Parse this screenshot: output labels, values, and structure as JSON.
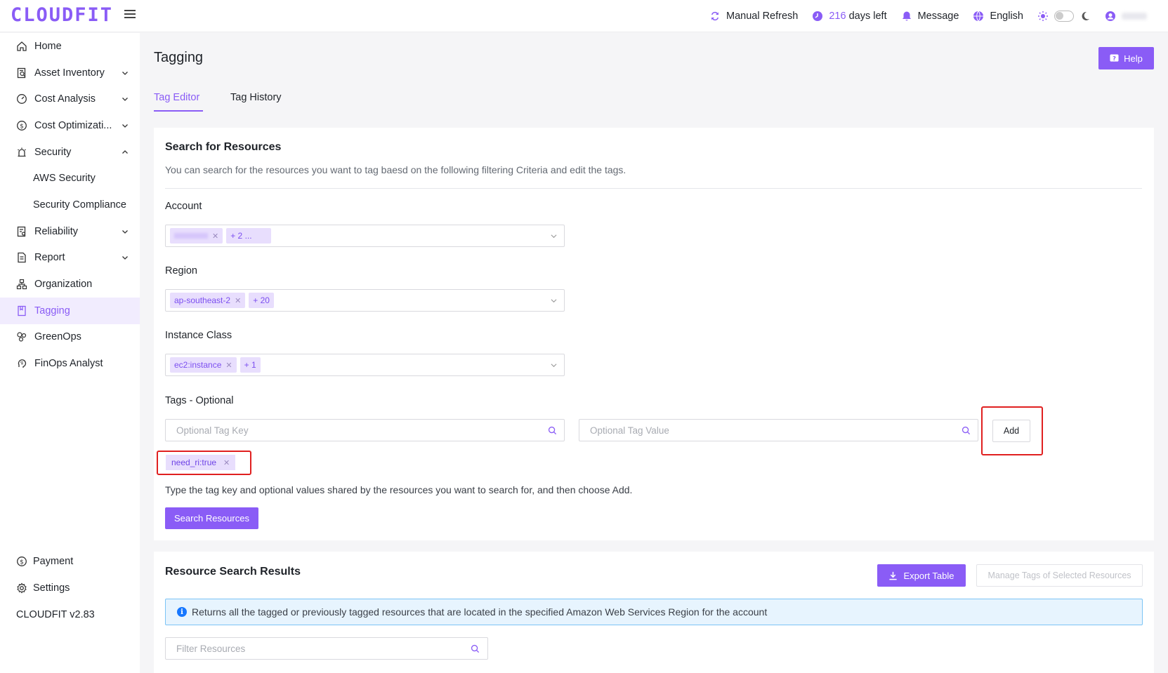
{
  "app": {
    "logo": "CLOUDFIT",
    "version": "CLOUDFIT v2.83"
  },
  "topbar": {
    "refresh_label": "Manual Refresh",
    "days_left_number": "216",
    "days_left_suffix": "days left",
    "message_label": "Message",
    "language_label": "English"
  },
  "sidebar": {
    "items": [
      {
        "label": "Home",
        "icon": "home-icon"
      },
      {
        "label": "Asset Inventory",
        "icon": "inventory-icon"
      },
      {
        "label": "Cost Analysis",
        "icon": "gauge-icon"
      },
      {
        "label": "Cost Optimizati...",
        "icon": "dollar-icon"
      },
      {
        "label": "Security",
        "icon": "alarm-icon"
      },
      {
        "label": "AWS Security"
      },
      {
        "label": "Security Compliance"
      },
      {
        "label": "Reliability",
        "icon": "document-check-icon"
      },
      {
        "label": "Report",
        "icon": "report-icon"
      },
      {
        "label": "Organization",
        "icon": "org-chart-icon"
      },
      {
        "label": "Tagging",
        "icon": "bookmark-icon"
      },
      {
        "label": "GreenOps",
        "icon": "leaf-icon"
      },
      {
        "label": "FinOps Analyst",
        "icon": "brain-icon"
      }
    ],
    "footer": [
      {
        "label": "Payment",
        "icon": "dollar-icon"
      },
      {
        "label": "Settings",
        "icon": "gear-icon"
      }
    ]
  },
  "page": {
    "title": "Tagging",
    "help_label": "Help",
    "tabs": [
      {
        "label": "Tag Editor"
      },
      {
        "label": "Tag History"
      }
    ]
  },
  "search": {
    "title": "Search for Resources",
    "description": "You can search for the resources you want to tag baesd on the following filtering Criteria and edit the tags.",
    "account": {
      "label": "Account",
      "more_chip": "+ 2 ..."
    },
    "region": {
      "label": "Region",
      "chip": "ap-southeast-2",
      "more_chip": "+ 20"
    },
    "instance_class": {
      "label": "Instance Class",
      "chip": "ec2:instance",
      "more_chip": "+ 1"
    },
    "tags": {
      "label": "Tags - Optional",
      "key_placeholder": "Optional Tag Key",
      "value_placeholder": "Optional Tag Value",
      "add_label": "Add",
      "selected_tag": "need_ri:true",
      "hint": "Type the tag key and optional values shared by the resources you want to search for, and then choose Add."
    },
    "search_button": "Search Resources"
  },
  "results": {
    "title": "Resource Search Results",
    "export_label": "Export Table",
    "manage_label": "Manage Tags of Selected Resources",
    "info": "Returns all the tagged or previously tagged resources that are located in the specified Amazon Web Services Region for the account",
    "filter_placeholder": "Filter Resources"
  },
  "colors": {
    "accent": "#8a5cf6",
    "chip_bg": "#e8defd",
    "info_bg": "#e7f4fe",
    "highlight": "#e02020"
  }
}
